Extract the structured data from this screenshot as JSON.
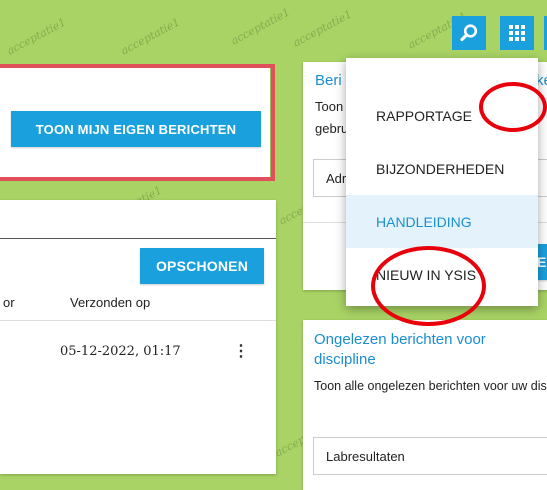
{
  "watermark": "acceptatie1",
  "left_panel": {
    "show_own_messages_button": "TOON MIJN EIGEN BERICHTEN",
    "cleanup_button": "OPSCHONEN",
    "column_partial": "or",
    "column_sent": "Verzonden op",
    "row": {
      "sent": "05-12-2022, 01:17",
      "more": "⋮"
    }
  },
  "right_panel": {
    "card1": {
      "title_partial": "Beri",
      "title_right": "ke",
      "text_line1": "Toon",
      "text_line2": "gebru",
      "select_partial": "Adr",
      "button_partial": "EN"
    },
    "card2": {
      "title": "Ongelezen berichten voor discipline",
      "text": "Toon alle ongelezen berichten voor uw discipline, met het volgende type:",
      "select_value": "Labresultaten"
    }
  },
  "topbar": {
    "search_icon": "search-icon",
    "apps_icon": "grid-icon"
  },
  "menu": {
    "items": [
      {
        "label": "RAPPORTAGE",
        "active": false
      },
      {
        "label": "BIJZONDERHEDEN",
        "active": false
      },
      {
        "label": "HANDLEIDING",
        "active": true
      },
      {
        "label": "NIEUW IN YSIS",
        "active": false
      }
    ]
  },
  "colors": {
    "background": "#a9d465",
    "accent": "#1aa0dc",
    "highlight": "#e0505a",
    "annotation": "#e8000a"
  }
}
